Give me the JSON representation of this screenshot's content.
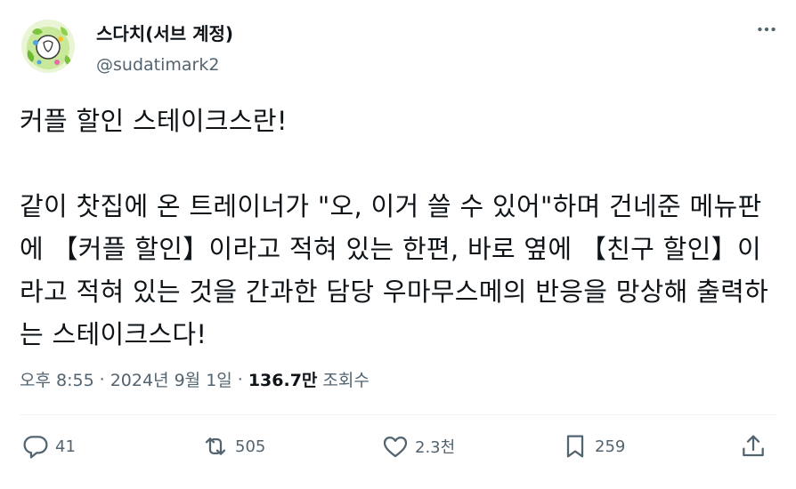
{
  "author": {
    "display_name": "스다치(서브 계정)",
    "handle": "@sudatimark2"
  },
  "tweet": {
    "text": "커플 할인 스테이크스란!\n\n같이 찻집에 온 트레이너가 \"오, 이거 쓸 수 있어\"하며 건네준 메뉴판에 【커플 할인】이라고 적혀 있는 한편, 바로 옆에 【친구 할인】이라고 적혀 있는 것을 간과한 담당 우마무스메의 반응을 망상해 출력하는 스테이크스다!"
  },
  "meta": {
    "time": "오후 8:55",
    "separator": "·",
    "date": "2024년 9월 1일",
    "views_count": "136.7만",
    "views_label": "조회수"
  },
  "actions": {
    "replies": "41",
    "reposts": "505",
    "likes": "2.3천",
    "bookmarks": "259"
  },
  "icons": {
    "more": "more-icon",
    "reply": "reply-icon",
    "repost": "repost-icon",
    "like": "heart-icon",
    "bookmark": "bookmark-icon",
    "share": "share-icon"
  },
  "colors": {
    "text": "#0f1419",
    "secondary": "#536471",
    "divider": "#eff3f4"
  }
}
